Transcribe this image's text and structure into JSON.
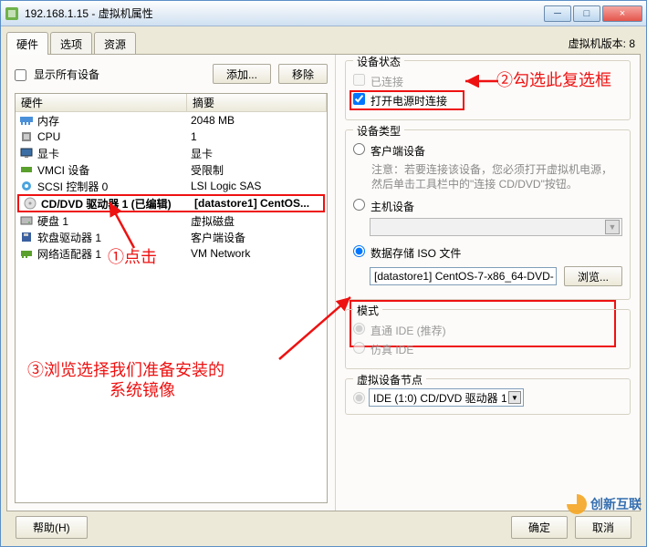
{
  "window": {
    "title": "192.168.1.15 - 虚拟机属性",
    "min": "─",
    "max": "□",
    "close": "×"
  },
  "vm_version_label": "虚拟机版本: 8",
  "tabs": {
    "hardware": "硬件",
    "options": "选项",
    "resources": "资源"
  },
  "left": {
    "show_all": "显示所有设备",
    "add_btn": "添加...",
    "remove_btn": "移除",
    "col_hardware": "硬件",
    "col_summary": "摘要",
    "rows": [
      {
        "icon": "ram-icon",
        "label": "内存",
        "summary": "2048 MB"
      },
      {
        "icon": "cpu-icon",
        "label": "CPU",
        "summary": "1"
      },
      {
        "icon": "video-icon",
        "label": "显卡",
        "summary": "显卡"
      },
      {
        "icon": "vmci-icon",
        "label": "VMCI 设备",
        "summary": "受限制"
      },
      {
        "icon": "scsi-icon",
        "label": "SCSI 控制器  0",
        "summary": "LSI Logic SAS"
      },
      {
        "icon": "cd-icon",
        "label": "CD/DVD 驱动器 1 (已编辑)",
        "summary": "[datastore1] CentOS..."
      },
      {
        "icon": "disk-icon",
        "label": "硬盘 1",
        "summary": "虚拟磁盘"
      },
      {
        "icon": "floppy-icon",
        "label": "软盘驱动器 1",
        "summary": "客户端设备"
      },
      {
        "icon": "nic-icon",
        "label": "网络适配器 1",
        "summary": "VM Network"
      }
    ]
  },
  "right": {
    "status": {
      "legend": "设备状态",
      "connected": "已连接",
      "connect_power": "打开电源时连接"
    },
    "type": {
      "legend": "设备类型",
      "client": "客户端设备",
      "client_note": "注意：若要连接该设备，您必须打开虚拟机电源，然后单击工具栏中的\"连接 CD/DVD\"按钮。",
      "host": "主机设备",
      "iso": "数据存储 ISO 文件",
      "iso_value": "[datastore1] CentOS-7-x86_64-DVD-",
      "browse": "浏览..."
    },
    "mode": {
      "legend": "模式",
      "passthrough": "直通 IDE (推荐)",
      "emulate": "仿真 IDE"
    },
    "vdn": {
      "legend": "虚拟设备节点",
      "value": "IDE (1:0) CD/DVD 驱动器 1"
    }
  },
  "bottom": {
    "help": "帮助(H)",
    "ok": "确定",
    "cancel": "取消"
  },
  "callouts": {
    "c1": "①点击",
    "c2": "②勾选此复选框",
    "c3a": "③浏览选择我们准备安装的",
    "c3b": "系统镜像"
  },
  "watermark": "创新互联"
}
